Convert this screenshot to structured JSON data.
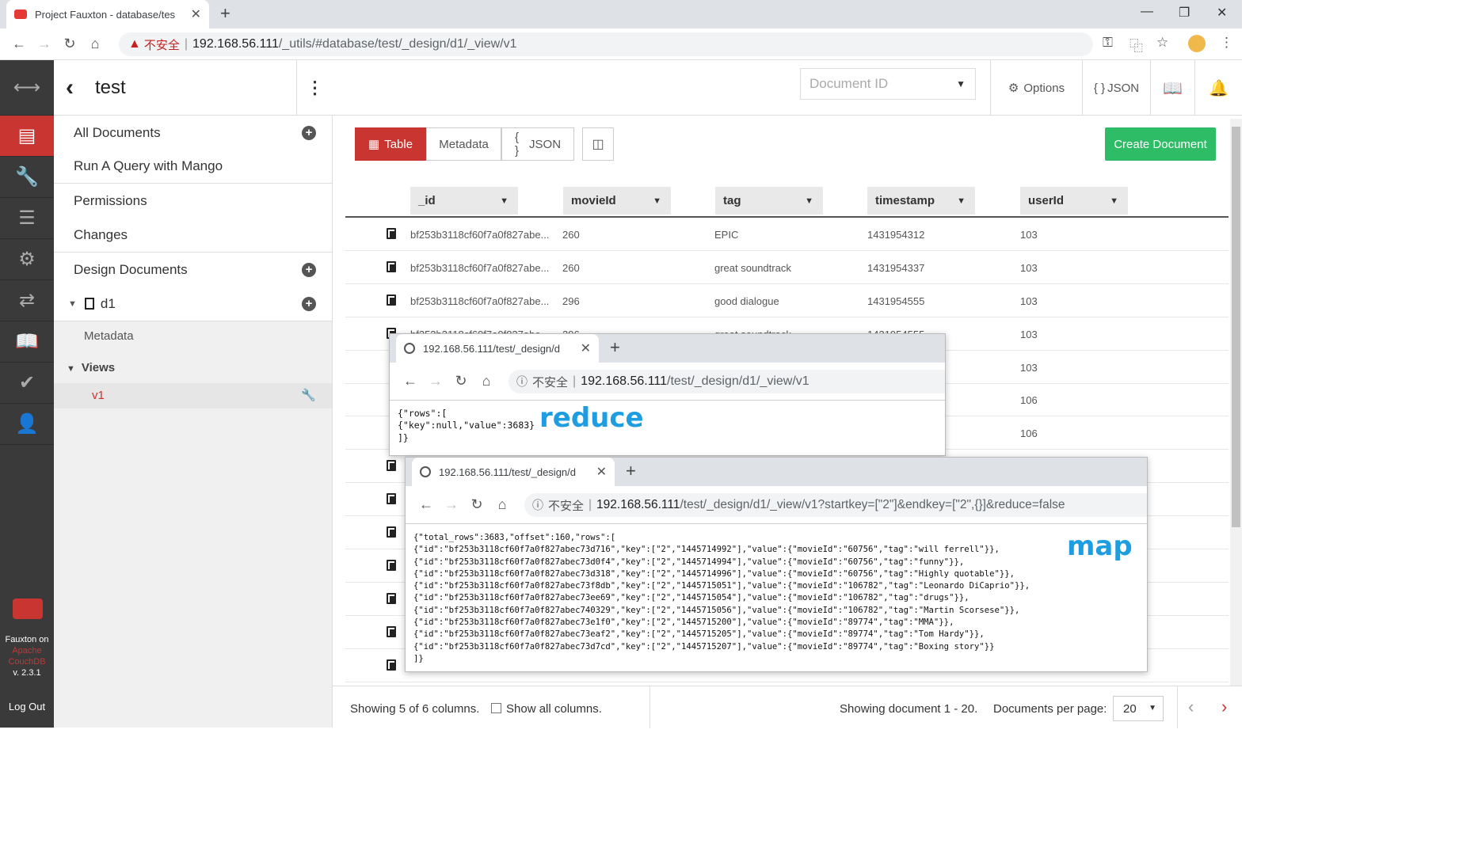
{
  "browser": {
    "tab_title": "Project Fauxton - database/tes",
    "insecure": "不安全",
    "url_host": "192.168.56.111",
    "url_path": "/_utils/#database/test/_design/d1/_view/v1"
  },
  "fauxton": {
    "brand": {
      "l1": "Fauxton on",
      "l2": "Apache",
      "l3": "CouchDB",
      "l4": "v. 2.3.1"
    },
    "logout": "Log Out",
    "db_name": "test",
    "sidebar": {
      "all_docs": "All Documents",
      "mango": "Run A Query with Mango",
      "permissions": "Permissions",
      "changes": "Changes",
      "design_docs": "Design Documents",
      "ddoc": "d1",
      "metadata": "Metadata",
      "views": "Views",
      "view": "v1"
    },
    "header": {
      "doc_id_placeholder": "Document ID",
      "options": "Options",
      "json": "JSON"
    },
    "view_tabs": {
      "table": "Table",
      "metadata": "Metadata",
      "json": "JSON"
    },
    "create": "Create Document",
    "columns": [
      "_id",
      "movieId",
      "tag",
      "timestamp",
      "userId"
    ],
    "rows": [
      {
        "id": "bf253b3118cf60f7a0f827abe...",
        "movieId": "260",
        "tag": "EPIC",
        "timestamp": "1431954312",
        "userId": "103"
      },
      {
        "id": "bf253b3118cf60f7a0f827abe...",
        "movieId": "260",
        "tag": "great soundtrack",
        "timestamp": "1431954337",
        "userId": "103"
      },
      {
        "id": "bf253b3118cf60f7a0f827abe...",
        "movieId": "296",
        "tag": "good dialogue",
        "timestamp": "1431954555",
        "userId": "103"
      },
      {
        "id": "bf253b3118cf60f7a0f827abe...",
        "movieId": "296",
        "tag": "great soundtrack",
        "timestamp": "1431954555",
        "userId": "103"
      },
      {
        "userId": "103"
      },
      {
        "userId": "106"
      },
      {
        "userId": "106"
      }
    ],
    "footer": {
      "showing_cols": "Showing 5 of 6 columns.",
      "show_all": "Show all columns.",
      "showing_docs": "Showing document 1 - 20.",
      "per_page_label": "Documents per page:",
      "per_page": "20"
    }
  },
  "reduce_window": {
    "tab_title": "192.168.56.111/test/_design/d",
    "insecure": "不安全",
    "url_host": "192.168.56.111",
    "url_path": "/test/_design/d1/_view/v1",
    "body": "{\"rows\":[\n{\"key\":null,\"value\":3683}\n]}",
    "label": "reduce"
  },
  "map_window": {
    "tab_title": "192.168.56.111/test/_design/d",
    "insecure": "不安全",
    "url_host": "192.168.56.111",
    "url_path": "/test/_design/d1/_view/v1?startkey=[\"2\"]&endkey=[\"2\",{}]&reduce=false",
    "body": "{\"total_rows\":3683,\"offset\":160,\"rows\":[\n{\"id\":\"bf253b3118cf60f7a0f827abec73d716\",\"key\":[\"2\",\"1445714992\"],\"value\":{\"movieId\":\"60756\",\"tag\":\"will ferrell\"}},\n{\"id\":\"bf253b3118cf60f7a0f827abec73d0f4\",\"key\":[\"2\",\"1445714994\"],\"value\":{\"movieId\":\"60756\",\"tag\":\"funny\"}},\n{\"id\":\"bf253b3118cf60f7a0f827abec73d318\",\"key\":[\"2\",\"1445714996\"],\"value\":{\"movieId\":\"60756\",\"tag\":\"Highly quotable\"}},\n{\"id\":\"bf253b3118cf60f7a0f827abec73f8db\",\"key\":[\"2\",\"1445715051\"],\"value\":{\"movieId\":\"106782\",\"tag\":\"Leonardo DiCaprio\"}},\n{\"id\":\"bf253b3118cf60f7a0f827abec73ee69\",\"key\":[\"2\",\"1445715054\"],\"value\":{\"movieId\":\"106782\",\"tag\":\"drugs\"}},\n{\"id\":\"bf253b3118cf60f7a0f827abec740329\",\"key\":[\"2\",\"1445715056\"],\"value\":{\"movieId\":\"106782\",\"tag\":\"Martin Scorsese\"}},\n{\"id\":\"bf253b3118cf60f7a0f827abec73e1f0\",\"key\":[\"2\",\"1445715200\"],\"value\":{\"movieId\":\"89774\",\"tag\":\"MMA\"}},\n{\"id\":\"bf253b3118cf60f7a0f827abec73eaf2\",\"key\":[\"2\",\"1445715205\"],\"value\":{\"movieId\":\"89774\",\"tag\":\"Tom Hardy\"}},\n{\"id\":\"bf253b3118cf60f7a0f827abec73d7cd\",\"key\":[\"2\",\"1445715207\"],\"value\":{\"movieId\":\"89774\",\"tag\":\"Boxing story\"}}\n]}",
    "label": "map"
  },
  "colors": {
    "accent": "#c93530",
    "create": "#2ebd66",
    "annotation": "#1e9ee0"
  }
}
